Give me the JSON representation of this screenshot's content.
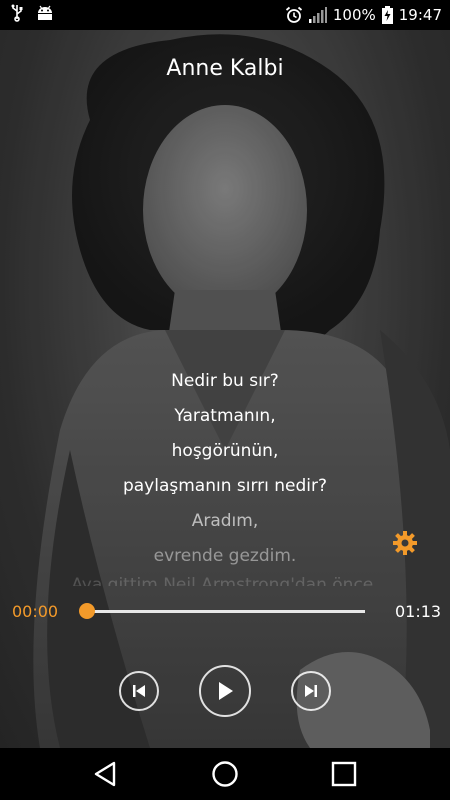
{
  "status_bar": {
    "battery": "100%",
    "time": "19:47",
    "icons": [
      "usb-icon",
      "android-debug-icon",
      "alarm-icon",
      "signal-icon",
      "battery-charging-icon"
    ]
  },
  "player": {
    "title": "Anne Kalbi",
    "lyrics": [
      "Nedir bu sır?",
      "Yaratmanın,",
      "hoşgörünün,",
      "paylaşmanın sırrı nedir?",
      "Aradım,",
      "evrende gezdim.",
      "Aya gittim Neil Armstrong'dan önce."
    ],
    "current_time": "00:00",
    "total_time": "01:13",
    "progress": 0.0
  },
  "colors": {
    "accent": "#f39a2a",
    "text": "#ffffff"
  },
  "nav_bar": {
    "icons": [
      "back-icon",
      "home-icon",
      "recents-icon"
    ]
  }
}
